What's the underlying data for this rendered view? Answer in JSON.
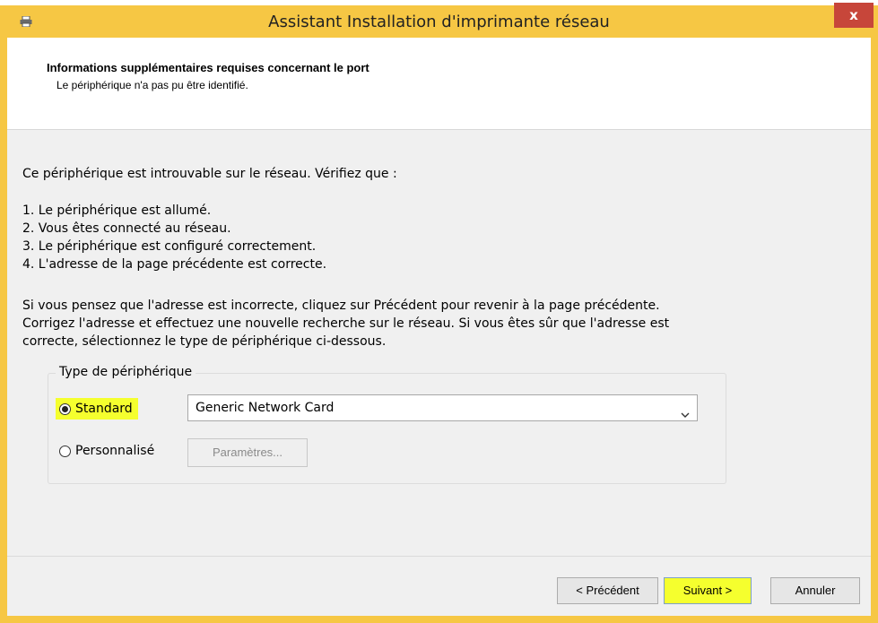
{
  "window": {
    "title": "Assistant Installation d'imprimante réseau",
    "close_label": "x",
    "accent_color": "#f6c744"
  },
  "header": {
    "title": "Informations supplémentaires requises concernant le port",
    "subtitle": "Le périphérique n'a pas pu être identifié."
  },
  "content": {
    "intro": "Ce périphérique est introuvable sur le réseau. Vérifiez que :",
    "checklist": [
      "1. Le périphérique est allumé.",
      "2. Vous êtes connecté au réseau.",
      "3. Le périphérique est configuré correctement.",
      "4. L'adresse de la page précédente est correcte."
    ],
    "advice_lines": [
      "Si vous pensez que l'adresse est incorrecte, cliquez sur Précédent pour revenir à la page précédente.",
      "Corrigez l'adresse et effectuez une nouvelle recherche sur le réseau. Si vous êtes sûr que l'adresse est",
      "correcte, sélectionnez le type de périphérique ci-dessous."
    ]
  },
  "device_type": {
    "legend": "Type de périphérique",
    "standard_label": "Standard",
    "standard_selected": true,
    "custom_label": "Personnalisé",
    "select_value": "Generic Network Card",
    "settings_label": "Paramètres..."
  },
  "footer": {
    "back_label": "< Précédent",
    "next_label": "Suivant >",
    "cancel_label": "Annuler"
  },
  "icons": {
    "app": "printer-icon",
    "dropdown": "chevron-down-icon"
  }
}
